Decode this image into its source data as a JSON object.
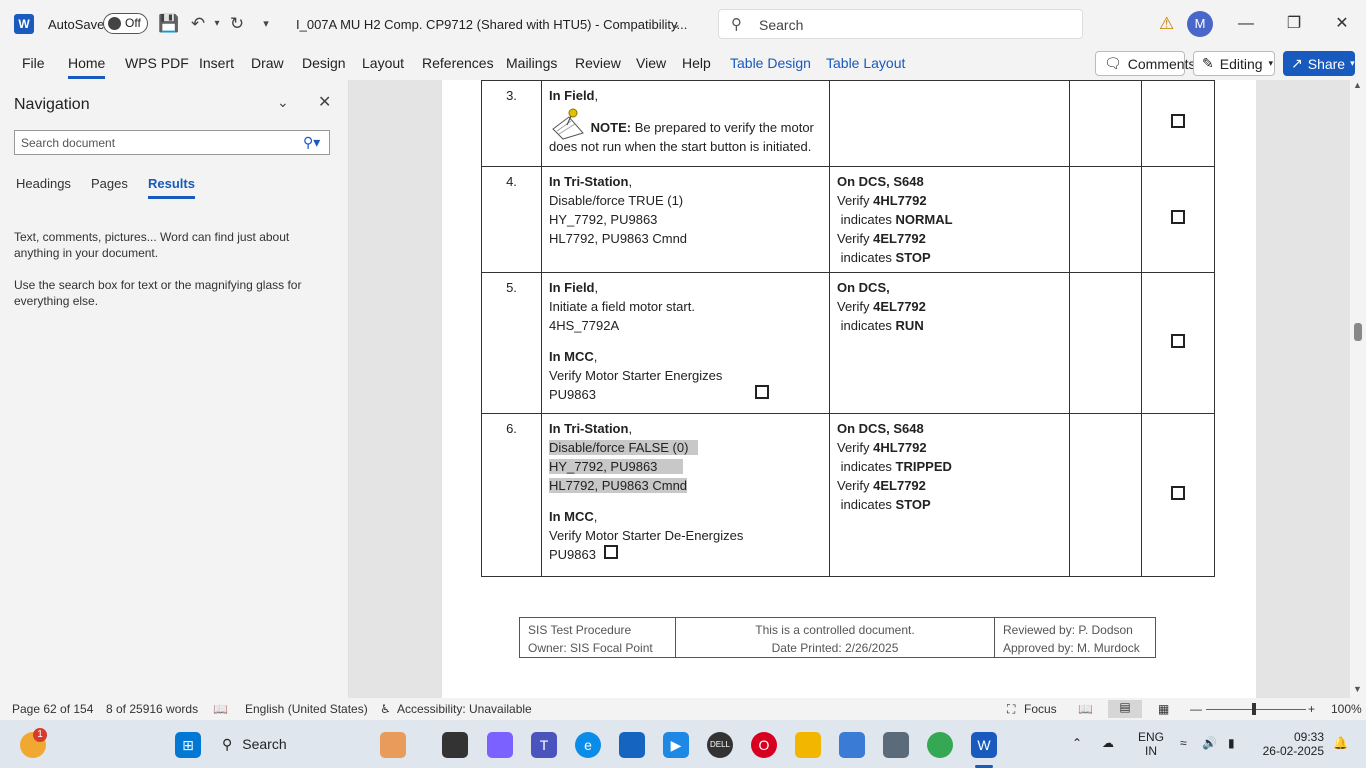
{
  "titlebar": {
    "autosave_label": "AutoSave",
    "autosave_state": "Off",
    "doc_title": "I_007A MU H2 Comp. CP9712 (Shared with HTU5)  -  Compatibility...",
    "search_placeholder": "Search",
    "avatar_initial": "M"
  },
  "ribbon": {
    "tabs": [
      "File",
      "Home",
      "WPS PDF",
      "Insert",
      "Draw",
      "Design",
      "Layout",
      "References",
      "Mailings",
      "Review",
      "View",
      "Help",
      "Table Design",
      "Table Layout"
    ],
    "comments_label": "Comments",
    "editing_label": "Editing",
    "share_label": "Share"
  },
  "nav": {
    "title": "Navigation",
    "search_placeholder": "Search document",
    "tabs": [
      "Headings",
      "Pages",
      "Results"
    ],
    "hint1": "Text, comments, pictures... Word can find just about anything in your document.",
    "hint2": "Use the search box for text or the magnifying glass for everything else."
  },
  "table": {
    "rows": [
      {
        "num": "3.",
        "act_title": "In Field",
        "note_label": "NOTE:",
        "note_text": " Be prepared to verify the motor does not run when the start button is initiated."
      },
      {
        "num": "4.",
        "act_title": "In Tri-Station",
        "act_l1": "Disable/force TRUE (1)",
        "act_l2": "HY_7792, PU9863",
        "act_l3": "HL7792, PU9863 Cmnd",
        "ver_title": "On DCS, S648",
        "v1a": "Verify ",
        "v1b": "4HL7792",
        "v2a": " indicates ",
        "v2b": "NORMAL",
        "v3a": "Verify ",
        "v3b": "4EL7792",
        "v4a": " indicates ",
        "v4b": "STOP"
      },
      {
        "num": "5.",
        "act_title": "In Field",
        "act_l1": "Initiate a field motor start.",
        "act_l2": "4HS_7792A",
        "mcc_title": "In MCC",
        "mcc_l1": "Verify Motor Starter Energizes",
        "mcc_l2": "PU9863",
        "ver_title": "On DCS,",
        "v1a": "Verify ",
        "v1b": "4EL7792",
        "v2a": " indicates ",
        "v2b": "RUN"
      },
      {
        "num": "6.",
        "act_title": "In Tri-Station",
        "act_l1": "Disable/force FALSE (0)",
        "act_l2": "HY_7792, PU9863",
        "act_l3": "HL7792, PU9863 Cmnd",
        "mcc_title": "In MCC",
        "mcc_l1": "Verify Motor Starter De-Energizes",
        "mcc_l2": "PU9863",
        "ver_title": "On DCS, S648",
        "v1a": "Verify ",
        "v1b": "4HL7792",
        "v2a": " indicates ",
        "v2b": "TRIPPED",
        "v3a": "Verify ",
        "v3b": "4EL7792",
        "v4a": " indicates ",
        "v4b": "STOP"
      }
    ]
  },
  "footer": {
    "c1a": "SIS Test Procedure",
    "c1b": "Owner: SIS Focal Point",
    "c2a": "This is a controlled document.",
    "c2b": "Date Printed: 2/26/2025",
    "c3a": "Reviewed by: P. Dodson",
    "c3b": "Approved by: M. Murdock"
  },
  "status": {
    "page": "Page 62 of 154",
    "words": "8 of 25916 words",
    "language": "English (United States)",
    "accessibility": "Accessibility: Unavailable",
    "focus": "Focus",
    "zoom": "100%"
  },
  "taskbar": {
    "search_label": "Search",
    "notif_count": "1",
    "lang1": "ENG",
    "lang2": "IN",
    "time": "09:33",
    "date": "26-02-2025"
  }
}
